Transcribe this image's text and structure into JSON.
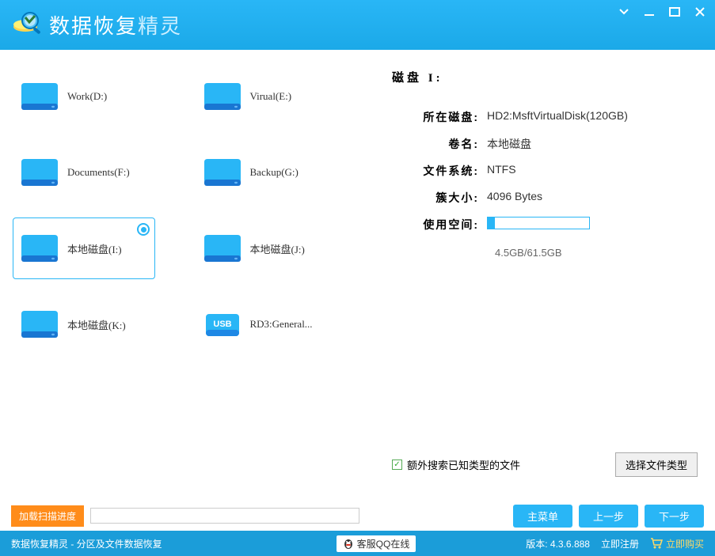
{
  "app": {
    "title1": "数据恢复",
    "title2": "精灵"
  },
  "drives": [
    {
      "label": "Work(D:)",
      "type": "hdd"
    },
    {
      "label": "Virual(E:)",
      "type": "hdd"
    },
    {
      "label": "Documents(F:)",
      "type": "hdd"
    },
    {
      "label": "Backup(G:)",
      "type": "hdd"
    },
    {
      "label": "本地磁盘(I:)",
      "type": "hdd",
      "selected": true
    },
    {
      "label": "本地磁盘(J:)",
      "type": "hdd"
    },
    {
      "label": "本地磁盘(K:)",
      "type": "hdd"
    },
    {
      "label": "RD3:General...",
      "type": "usb"
    }
  ],
  "info": {
    "title": "磁盘 I:",
    "disk_label": "所在磁盘:",
    "disk_value": "HD2:MsftVirtualDisk(120GB)",
    "vol_label": "卷名:",
    "vol_value": "本地磁盘",
    "fs_label": "文件系统:",
    "fs_value": "NTFS",
    "cluster_label": "簇大小:",
    "cluster_value": "4096 Bytes",
    "usage_label": "使用空间:",
    "usage_text": "4.5GB/61.5GB",
    "usage_pct": 7
  },
  "options": {
    "chk_label": "额外搜索已知类型的文件",
    "select_btn": "选择文件类型"
  },
  "footer": {
    "load": "加载扫描进度",
    "menu": "主菜单",
    "prev": "上一步",
    "next": "下一步"
  },
  "status": {
    "app": "数据恢复精灵 - 分区及文件数据恢复",
    "qq": "客服QQ在线",
    "version": "版本: 4.3.6.888",
    "register": "立即注册",
    "buy": "立即购买"
  }
}
